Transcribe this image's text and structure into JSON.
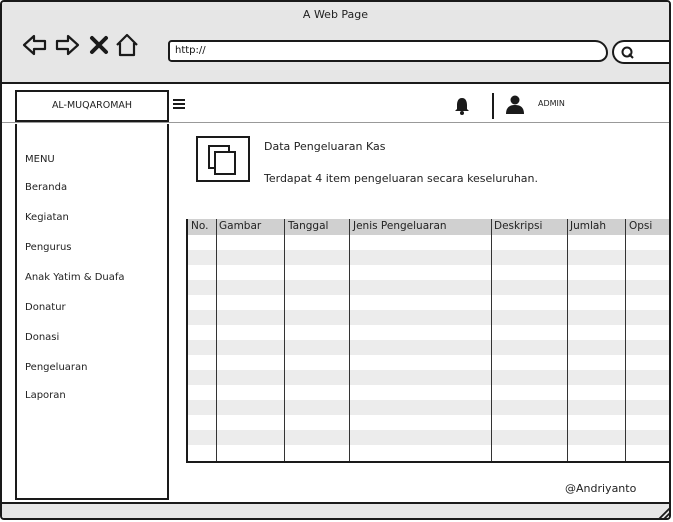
{
  "window": {
    "title": "A Web Page",
    "url": "http://"
  },
  "header": {
    "brand": "AL-MUQAROMAH",
    "user": "ADMIN"
  },
  "sidebar": {
    "heading": "MENU",
    "items": [
      "Beranda",
      "Kegiatan",
      "Pengurus",
      "Anak Yatim & Duafa",
      "Donatur",
      "Donasi",
      "Pengeluaran",
      "Laporan"
    ]
  },
  "main": {
    "title": "Data Pengeluaran Kas",
    "description": "Terdapat 4 item pengeluaran secara keseluruhan.",
    "table": {
      "columns": [
        "No.",
        "Gambar",
        "Tanggal",
        "Jenis Pengeluaran",
        "Deskripsi",
        "Jumlah",
        "Opsi"
      ],
      "rows": []
    }
  },
  "footer": {
    "credit": "@Andriyanto"
  }
}
